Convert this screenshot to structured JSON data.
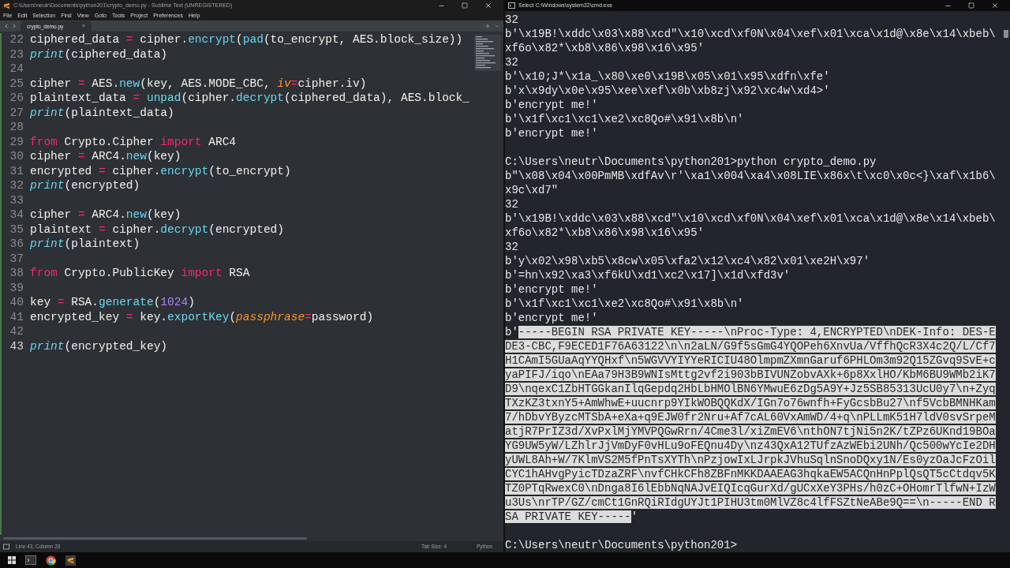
{
  "editor": {
    "title": "C:\\Users\\neutr\\Documents\\python201\\crypto_demo.py - Sublime Text (UNREGISTERED)",
    "menu": [
      "File",
      "Edit",
      "Selection",
      "Find",
      "View",
      "Goto",
      "Tools",
      "Project",
      "Preferences",
      "Help"
    ],
    "tabs": [
      {
        "label": "crypto_demo.py",
        "selected": true,
        "close": "×"
      }
    ],
    "lines": [
      {
        "number": "22",
        "current": false,
        "tokens": [
          {
            "kind": "plain",
            "text": "ciphered_data "
          },
          {
            "kind": "op",
            "text": "="
          },
          {
            "kind": "plain",
            "text": " cipher."
          },
          {
            "kind": "call",
            "text": "encrypt"
          },
          {
            "kind": "plain",
            "text": "("
          },
          {
            "kind": "call",
            "text": "pad"
          },
          {
            "kind": "plain",
            "text": "(to_encrypt, AES.block_size))"
          }
        ]
      },
      {
        "number": "23",
        "current": false,
        "tokens": [
          {
            "kind": "builtin",
            "text": "print"
          },
          {
            "kind": "plain",
            "text": "(ciphered_data)"
          }
        ]
      },
      {
        "number": "24",
        "current": false
      },
      {
        "number": "25",
        "current": false,
        "tokens": [
          {
            "kind": "plain",
            "text": "cipher "
          },
          {
            "kind": "op",
            "text": "="
          },
          {
            "kind": "plain",
            "text": " AES."
          },
          {
            "kind": "call",
            "text": "new"
          },
          {
            "kind": "plain",
            "text": "(key, AES.MODE_CBC, "
          },
          {
            "kind": "param",
            "text": "iv"
          },
          {
            "kind": "op",
            "text": "="
          },
          {
            "kind": "plain",
            "text": "cipher.iv)"
          }
        ]
      },
      {
        "number": "26",
        "current": false,
        "tokens": [
          {
            "kind": "plain",
            "text": "plaintext_data "
          },
          {
            "kind": "op",
            "text": "="
          },
          {
            "kind": "call",
            "text": " unpad"
          },
          {
            "kind": "plain",
            "text": "(cipher."
          },
          {
            "kind": "call",
            "text": "decrypt"
          },
          {
            "kind": "plain",
            "text": "(ciphered_data), AES.block_"
          }
        ]
      },
      {
        "number": "27",
        "current": false,
        "tokens": [
          {
            "kind": "builtin",
            "text": "print"
          },
          {
            "kind": "plain",
            "text": "(plaintext_data)"
          }
        ]
      },
      {
        "number": "28",
        "current": false
      },
      {
        "number": "29",
        "current": false,
        "tokens": [
          {
            "kind": "keyword",
            "text": "from"
          },
          {
            "kind": "plain",
            "text": " Crypto.Cipher "
          },
          {
            "kind": "keyword",
            "text": "import"
          },
          {
            "kind": "plain",
            "text": " ARC4"
          }
        ]
      },
      {
        "number": "30",
        "current": false,
        "tokens": [
          {
            "kind": "plain",
            "text": "cipher "
          },
          {
            "kind": "op",
            "text": "="
          },
          {
            "kind": "plain",
            "text": " ARC4."
          },
          {
            "kind": "call",
            "text": "new"
          },
          {
            "kind": "plain",
            "text": "(key)"
          }
        ]
      },
      {
        "number": "31",
        "current": false,
        "tokens": [
          {
            "kind": "plain",
            "text": "encrypted "
          },
          {
            "kind": "op",
            "text": "="
          },
          {
            "kind": "plain",
            "text": " cipher."
          },
          {
            "kind": "call",
            "text": "encrypt"
          },
          {
            "kind": "plain",
            "text": "(to_encrypt)"
          }
        ]
      },
      {
        "number": "32",
        "current": false,
        "tokens": [
          {
            "kind": "builtin",
            "text": "print"
          },
          {
            "kind": "plain",
            "text": "(encrypted)"
          }
        ]
      },
      {
        "number": "33",
        "current": false
      },
      {
        "number": "34",
        "current": false,
        "tokens": [
          {
            "kind": "plain",
            "text": "cipher "
          },
          {
            "kind": "op",
            "text": "="
          },
          {
            "kind": "plain",
            "text": " ARC4."
          },
          {
            "kind": "call",
            "text": "new"
          },
          {
            "kind": "plain",
            "text": "(key)"
          }
        ]
      },
      {
        "number": "35",
        "current": false,
        "tokens": [
          {
            "kind": "plain",
            "text": "plaintext "
          },
          {
            "kind": "op",
            "text": "="
          },
          {
            "kind": "plain",
            "text": " cipher."
          },
          {
            "kind": "call",
            "text": "decrypt"
          },
          {
            "kind": "plain",
            "text": "(encrypted)"
          }
        ]
      },
      {
        "number": "36",
        "current": false,
        "tokens": [
          {
            "kind": "builtin",
            "text": "print"
          },
          {
            "kind": "plain",
            "text": "(plaintext)"
          }
        ]
      },
      {
        "number": "37",
        "current": false
      },
      {
        "number": "38",
        "current": false,
        "tokens": [
          {
            "kind": "keyword",
            "text": "from"
          },
          {
            "kind": "plain",
            "text": " Crypto.PublicKey "
          },
          {
            "kind": "keyword",
            "text": "import"
          },
          {
            "kind": "plain",
            "text": " RSA"
          }
        ]
      },
      {
        "number": "39",
        "current": false
      },
      {
        "number": "40",
        "current": false,
        "tokens": [
          {
            "kind": "plain",
            "text": "key "
          },
          {
            "kind": "op",
            "text": "="
          },
          {
            "kind": "plain",
            "text": " RSA."
          },
          {
            "kind": "call",
            "text": "generate"
          },
          {
            "kind": "plain",
            "text": "("
          },
          {
            "kind": "number",
            "text": "1024"
          },
          {
            "kind": "plain",
            "text": ")"
          }
        ]
      },
      {
        "number": "41",
        "current": false,
        "tokens": [
          {
            "kind": "plain",
            "text": "encrypted_key "
          },
          {
            "kind": "op",
            "text": "="
          },
          {
            "kind": "plain",
            "text": " key."
          },
          {
            "kind": "call",
            "text": "exportKey"
          },
          {
            "kind": "plain",
            "text": "("
          },
          {
            "kind": "param",
            "text": "passphrase"
          },
          {
            "kind": "op",
            "text": "="
          },
          {
            "kind": "plain",
            "text": "password)"
          }
        ]
      },
      {
        "number": "42",
        "current": false
      },
      {
        "number": "43",
        "current": true,
        "tokens": [
          {
            "kind": "builtin",
            "text": "print"
          },
          {
            "kind": "plain",
            "text": "(encrypted_key)"
          }
        ]
      }
    ],
    "status_bar": {
      "position": "Line 43, Column 20",
      "tab_size": "Tab Size: 4",
      "syntax": "Python"
    }
  },
  "terminal": {
    "title": "Select C:\\Windows\\system32\\cmd.exe",
    "lines": [
      {
        "kind": "text",
        "segments": [
          {
            "text": "32",
            "selected": false
          }
        ]
      },
      {
        "kind": "text",
        "segments": [
          {
            "text": "b'\\x19B!\\xddc\\x03\\x88\\xcd\"\\x10\\xcd\\xf0N\\x04\\xef\\x01\\xca\\x1d@\\x8e\\x14\\xbeb\\",
            "selected": false
          }
        ]
      },
      {
        "kind": "text",
        "segments": [
          {
            "text": "xf6o\\x82*\\xb8\\x86\\x98\\x16\\x95'",
            "selected": false
          }
        ]
      },
      {
        "kind": "text",
        "segments": [
          {
            "text": "32",
            "selected": false
          }
        ]
      },
      {
        "kind": "text",
        "segments": [
          {
            "text": "b'\\x10;J*\\x1a_\\x80\\xe0\\x19B\\x05\\x01\\x95\\xdfn\\xfe'",
            "selected": false
          }
        ]
      },
      {
        "kind": "text",
        "segments": [
          {
            "text": "b'x\\x9dy\\x0e\\x95\\xee\\xef\\x0b\\xb8zj\\x92\\xc4w\\xd4>'",
            "selected": false
          }
        ]
      },
      {
        "kind": "text",
        "segments": [
          {
            "text": "b'encrypt me!'",
            "selected": false
          }
        ]
      },
      {
        "kind": "text",
        "segments": [
          {
            "text": "b'\\x1f\\xc1\\xc1\\xe2\\xc8Qo#\\x91\\x8b\\n'",
            "selected": false
          }
        ]
      },
      {
        "kind": "text",
        "segments": [
          {
            "text": "b'encrypt me!'",
            "selected": false
          }
        ]
      },
      {
        "kind": "blank"
      },
      {
        "kind": "text",
        "segments": [
          {
            "text": "C:\\Users\\neutr\\Documents\\python201>python crypto_demo.py",
            "selected": false
          }
        ]
      },
      {
        "kind": "text",
        "segments": [
          {
            "text": "b\"\\x08\\x04\\x00PmMB\\xdfAv\\r'\\xa1\\x004\\xa4\\x08LIE\\x86x\\t\\xc0\\x0c<}\\xaf\\x1b6\\",
            "selected": false
          }
        ]
      },
      {
        "kind": "text",
        "segments": [
          {
            "text": "x9c\\xd7\"",
            "selected": false
          }
        ]
      },
      {
        "kind": "text",
        "segments": [
          {
            "text": "32",
            "selected": false
          }
        ]
      },
      {
        "kind": "text",
        "segments": [
          {
            "text": "b'\\x19B!\\xddc\\x03\\x88\\xcd\"\\x10\\xcd\\xf0N\\x04\\xef\\x01\\xca\\x1d@\\x8e\\x14\\xbeb\\",
            "selected": false
          }
        ]
      },
      {
        "kind": "text",
        "segments": [
          {
            "text": "xf6o\\x82*\\xb8\\x86\\x98\\x16\\x95'",
            "selected": false
          }
        ]
      },
      {
        "kind": "text",
        "segments": [
          {
            "text": "32",
            "selected": false
          }
        ]
      },
      {
        "kind": "text",
        "segments": [
          {
            "text": "b'y\\x02\\x98\\xb5\\x8cw\\x05\\xfa2\\x12\\xc4\\x82\\x01\\xe2H\\x97'",
            "selected": false
          }
        ]
      },
      {
        "kind": "text",
        "segments": [
          {
            "text": "b'=hn\\x92\\xa3\\xf6kU\\xd1\\xc2\\x17]\\x1d\\xfd3v'",
            "selected": false
          }
        ]
      },
      {
        "kind": "text",
        "segments": [
          {
            "text": "b'encrypt me!'",
            "selected": false
          }
        ]
      },
      {
        "kind": "text",
        "segments": [
          {
            "text": "b'\\x1f\\xc1\\xc1\\xe2\\xc8Qo#\\x91\\x8b\\n'",
            "selected": false
          }
        ]
      },
      {
        "kind": "text",
        "segments": [
          {
            "text": "b'encrypt me!'",
            "selected": false
          }
        ]
      },
      {
        "kind": "text",
        "segments": [
          {
            "text": "b'",
            "selected": false
          },
          {
            "text": "-----BEGIN RSA PRIVATE KEY-----\\nProc-Type: 4,ENCRYPTED\\nDEK-Info: DES-E",
            "selected": true
          }
        ]
      },
      {
        "kind": "text",
        "segments": [
          {
            "text": "DE3-CBC,F9ECED1F76A63122\\n\\n2aLN/G9f5sGmG4YQOPeh6XnvUa/VffhQcR3X4c2Q/L/Cf7",
            "selected": true
          }
        ]
      },
      {
        "kind": "text",
        "segments": [
          {
            "text": "H1CAmI5GUaAqYYQHxf\\n5WGVVYIYYeRICIU48OlmpmZXmnGaruf6PHLOm3m92Q15ZGvq9SvE+c",
            "selected": true
          }
        ]
      },
      {
        "kind": "text",
        "segments": [
          {
            "text": "yaPIFJ/iqo\\nEAa79H3B9WNIsMttg2vf2i903bBIVUNZobvAXk+6p8XxlHO/KbM6BU9WMb2iK7",
            "selected": true
          }
        ]
      },
      {
        "kind": "text",
        "segments": [
          {
            "text": "D9\\nqexC1ZbHTGGkanIlqGepdq2HbLbHMOlBN6YMwuE6zDg5A9Y+Jz5SB85313UcU0y7\\n+Zyq",
            "selected": true
          }
        ]
      },
      {
        "kind": "text",
        "segments": [
          {
            "text": "TXzKZ3txnY5+AmWhwE+uucnrp9YIkWOBQQKdX/IGn7o76wnfh+FyGcsbBu27\\nf5VcbBMNHKam",
            "selected": true
          }
        ]
      },
      {
        "kind": "text",
        "segments": [
          {
            "text": "7/hDbvYByzcMTSbA+eXa+q9EJW0fr2Nru+Af7cAL60VxAmWD/4+q\\nPLLmK51H7ldV0svSrpeM",
            "selected": true
          }
        ]
      },
      {
        "kind": "text",
        "segments": [
          {
            "text": "atjR7PrIZ3d/XvPxlMjYMVPQGwRrn/4Cme3l/xiZmEV6\\nthON7tjNi5n2K/tZPz6UKnd19BOa",
            "selected": true
          }
        ]
      },
      {
        "kind": "text",
        "segments": [
          {
            "text": "YG9UW5yW/LZhlrJjVmDyF0vHLu9oFEQnu4Dy\\nz43QxA12TUfzAzWEbi2UNh/Qc500wYcIe2DH",
            "selected": true
          }
        ]
      },
      {
        "kind": "text",
        "segments": [
          {
            "text": "yUWL8Ah+W/7KlmVS2M5fPnTsXYTh\\nPzjowIxLJrpkJVhuSqlnSnoDQxy1N/Es0yzOaJcFzOil",
            "selected": true
          }
        ]
      },
      {
        "kind": "text",
        "segments": [
          {
            "text": "CYC1hAHvgPyicTDzaZRF\\nvfCHkCFh8ZBFnMKKDAAEAG3hqkaEW5ACQnHnPplQsQT5cCtdqv5K",
            "selected": true
          }
        ]
      },
      {
        "kind": "text",
        "segments": [
          {
            "text": "TZ0PTqRwexC0\\nDnga8I6lEbbNqNAJvEIQIcqGurXd/gUCxXeY3PHs/h0zC+OHomrTlfwN+IzW",
            "selected": true
          }
        ]
      },
      {
        "kind": "text",
        "segments": [
          {
            "text": "u3Us\\nrTP/GZ/cmCt1GnRQiRIdgUYJt1PIHU3tm0MlVZ8c4lfFSZtNeABe9Q==\\n-----END R",
            "selected": true
          }
        ]
      },
      {
        "kind": "text",
        "segments": [
          {
            "text": "SA PRIVATE KEY-----",
            "selected": true
          },
          {
            "text": "'",
            "selected": false
          }
        ]
      },
      {
        "kind": "blank"
      },
      {
        "kind": "text",
        "segments": [
          {
            "text": "C:\\Users\\neutr\\Documents\\python201>",
            "selected": false
          }
        ]
      }
    ]
  }
}
